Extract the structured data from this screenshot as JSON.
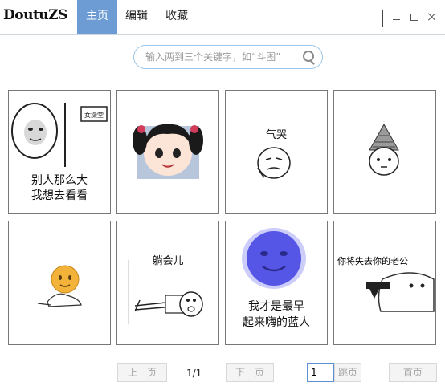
{
  "app": {
    "logo": "DoutuZS"
  },
  "nav": {
    "items": [
      {
        "label": "主页",
        "active": true
      },
      {
        "label": "编辑"
      },
      {
        "label": "收藏"
      }
    ]
  },
  "search": {
    "placeholder": "输入两到三个关键字，如“斗图”"
  },
  "memes": [
    {
      "caption_lines": [
        "别人那么大",
        "我想去看看"
      ],
      "sign_text": "女澡堂",
      "icon": "panda-meme-peeking"
    },
    {
      "icon": "anime-girl-twintails"
    },
    {
      "caption_lines": [
        "气哭"
      ],
      "icon": "crying-panda-sketch"
    },
    {
      "icon": "pine-cone-hat-face"
    },
    {
      "icon": "orange-emoji-sitting"
    },
    {
      "caption_lines": [
        "躺会儿"
      ],
      "icon": "lying-down-sketch"
    },
    {
      "caption_lines": [
        "我才是最早",
        "起来嗨的蓝人"
      ],
      "icon": "blue-face-meme"
    },
    {
      "caption_lines": [
        "你将失去你的老公"
      ],
      "icon": "seal-pointing-gun"
    }
  ],
  "pager": {
    "prev": "上一页",
    "info": "1/1",
    "next": "下一页",
    "page_value": "1",
    "jump": "跳页",
    "home": "首页"
  },
  "colors": {
    "accent": "#6d9bd3",
    "search_border": "#9cc7ea"
  }
}
